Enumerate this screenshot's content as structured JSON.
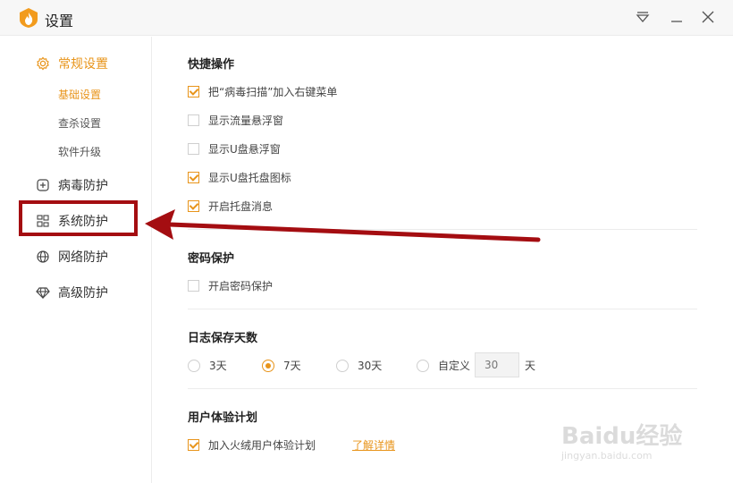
{
  "window": {
    "title": "设置"
  },
  "sidebar": {
    "items": [
      {
        "label": "常规设置",
        "icon": "gear-icon"
      },
      {
        "label": "病毒防护",
        "icon": "plus-square-icon"
      },
      {
        "label": "系统防护",
        "icon": "system-blocks-icon"
      },
      {
        "label": "网络防护",
        "icon": "globe-icon"
      },
      {
        "label": "高级防护",
        "icon": "diamond-icon"
      }
    ],
    "subitems": [
      "基础设置",
      "查杀设置",
      "软件升级"
    ],
    "active_item": "常规设置",
    "active_subitem": "基础设置"
  },
  "main": {
    "quick_ops": {
      "title": "快捷操作",
      "options": [
        {
          "label": "把“病毒扫描”加入右键菜单",
          "checked": true
        },
        {
          "label": "显示流量悬浮窗",
          "checked": false
        },
        {
          "label": "显示U盘悬浮窗",
          "checked": false
        },
        {
          "label": "显示U盘托盘图标",
          "checked": true
        },
        {
          "label": "开启托盘消息",
          "checked": true
        }
      ]
    },
    "password": {
      "title": "密码保护",
      "options": [
        {
          "label": "开启密码保护",
          "checked": false
        }
      ]
    },
    "log_days": {
      "title": "日志保存天数",
      "options": [
        "3天",
        "7天",
        "30天",
        "自定义"
      ],
      "selected": "7天",
      "custom_value": "30",
      "unit": "天"
    },
    "ux_plan": {
      "title": "用户体验计划",
      "option": {
        "label": "加入火绒用户体验计划",
        "checked": true
      },
      "link": "了解详情"
    }
  },
  "watermark": {
    "text": "Baidu经验",
    "url": "jingyan.baidu.com"
  },
  "colors": {
    "accent": "#e8941a",
    "highlight": "#a40d11"
  }
}
